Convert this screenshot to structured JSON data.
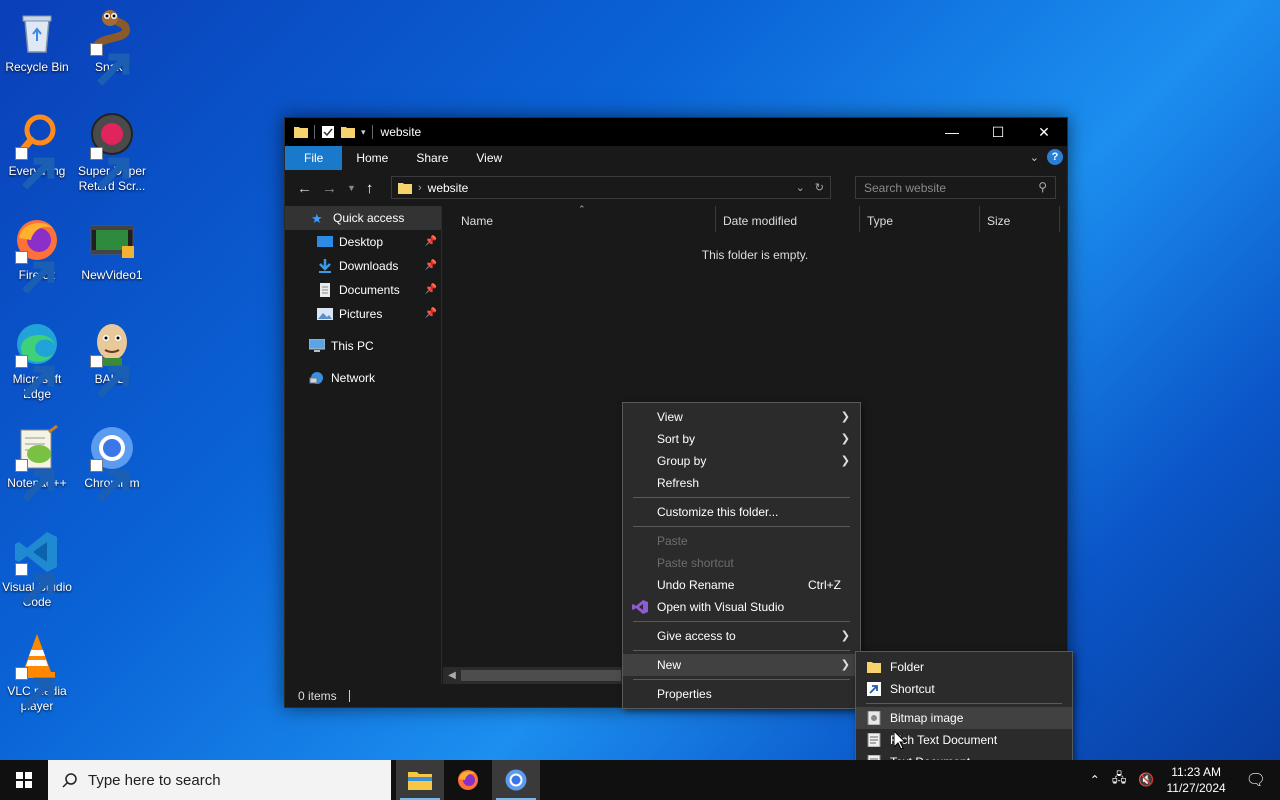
{
  "desktop": {
    "icons": [
      {
        "label": "Recycle Bin"
      },
      {
        "label": "Snake"
      },
      {
        "label": "Everything"
      },
      {
        "label": "Super Duper Retard Scr..."
      },
      {
        "label": "Firefox"
      },
      {
        "label": "NewVideo1"
      },
      {
        "label": "Microsoft Edge"
      },
      {
        "label": "BALDI"
      },
      {
        "label": "Notepad++"
      },
      {
        "label": "Chromium"
      },
      {
        "label": "Visual Studio Code"
      },
      {
        "label": "VLC media player"
      }
    ]
  },
  "explorer": {
    "title": "website",
    "ribbon_tabs": [
      "File",
      "Home",
      "Share",
      "View"
    ],
    "help_icon": "?",
    "address": "website",
    "search_placeholder": "Search website",
    "nav": {
      "quick_access": "Quick access",
      "desktop": "Desktop",
      "downloads": "Downloads",
      "documents": "Documents",
      "pictures": "Pictures",
      "this_pc": "This PC",
      "network": "Network"
    },
    "columns": [
      "Name",
      "Date modified",
      "Type",
      "Size"
    ],
    "empty_text": "This folder is empty.",
    "status": "0 items"
  },
  "context_menu": {
    "view": "View",
    "sort_by": "Sort by",
    "group_by": "Group by",
    "refresh": "Refresh",
    "customize": "Customize this folder...",
    "paste": "Paste",
    "paste_shortcut": "Paste shortcut",
    "undo_rename": "Undo Rename",
    "undo_accel": "Ctrl+Z",
    "open_vs": "Open with Visual Studio",
    "give_access": "Give access to",
    "new": "New",
    "properties": "Properties"
  },
  "new_submenu": {
    "folder": "Folder",
    "shortcut": "Shortcut",
    "bitmap": "Bitmap image",
    "rich_text": "Rich Text Document",
    "text": "Text Document"
  },
  "taskbar": {
    "search_placeholder": "Type here to search",
    "time": "11:23 AM",
    "date": "11/27/2024"
  },
  "colors": {
    "file_tab": "#1979ca",
    "menu_bg": "#2b2b2b",
    "window_bg": "#191919"
  }
}
